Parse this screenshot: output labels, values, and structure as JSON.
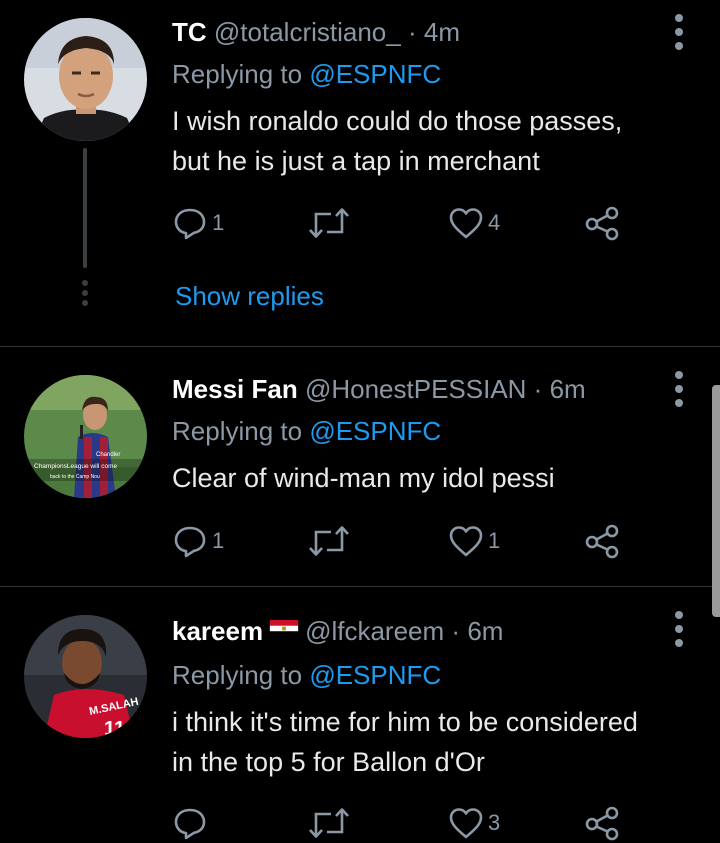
{
  "tweets": [
    {
      "name": "TC",
      "handle": "@totalcristiano_",
      "separator": "·",
      "time": "4m",
      "replying_prefix": "Replying to ",
      "replying_to": "@ESPNFC",
      "text_line1": "I wish ronaldo could do those passes,",
      "text_line2": "but he is just a tap in merchant",
      "reply_count": "1",
      "retweet_count": "",
      "like_count": "4",
      "show_replies": "Show replies"
    },
    {
      "name": "Messi Fan",
      "handle": "@HonestPESSIAN",
      "separator": "·",
      "time": "6m",
      "replying_prefix": "Replying to ",
      "replying_to": "@ESPNFC",
      "text_line1": "Clear of wind-man my idol pessi",
      "reply_count": "1",
      "retweet_count": "",
      "like_count": "1",
      "avatar_caption_line1": "Chandler",
      "avatar_caption_line2": "ChampionsLeague will come",
      "avatar_caption_line3": "back to the Camp Nou"
    },
    {
      "name": "kareem",
      "flag": "egypt-flag-emoji",
      "handle": "@lfckareem",
      "separator": "·",
      "time": "6m",
      "replying_prefix": "Replying to ",
      "replying_to": "@ESPNFC",
      "text_line1": "i think it's time for him to be considered",
      "text_line2": "in the top 5 for Ballon d'Or",
      "reply_count": "",
      "retweet_count": "",
      "like_count": "3",
      "avatar_shirt_name": "M.SALAH",
      "avatar_shirt_number": "11"
    }
  ],
  "icons": {
    "reply": "speech-bubble-icon",
    "retweet": "retweet-arrows-icon",
    "like": "heart-outline-icon",
    "share": "share-nodes-icon",
    "more": "vertical-dots-icon"
  },
  "colors": {
    "background": "#000000",
    "link": "#1d9bf0",
    "secondary_text": "#8b98a5",
    "divider": "#2f3336"
  }
}
